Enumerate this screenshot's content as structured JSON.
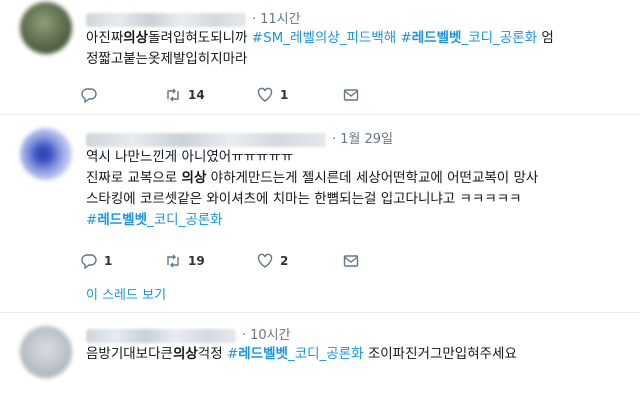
{
  "tweets": [
    {
      "time": "11시간",
      "lines": [
        [
          {
            "t": "아진짜"
          },
          {
            "t": "의상",
            "b": true
          },
          {
            "t": "돌려입혀도되니까 "
          },
          {
            "t": "#SM_레벨의상_피드백해 ",
            "hl": true
          },
          {
            "t": "#",
            "hl": true
          },
          {
            "t": "레드벨벳",
            "hl": true,
            "b": true
          },
          {
            "t": "_코디_공론화",
            "hl": true
          },
          {
            "t": " 엄"
          }
        ],
        [
          {
            "t": "정짧고붙는옷제발입히지마라"
          }
        ]
      ],
      "actions": {
        "reply": "",
        "retweet": "14",
        "like": "1"
      }
    },
    {
      "time": "1월 29일",
      "lines": [
        [
          {
            "t": "역시 나만느낀게 아니였어ㅠㅠㅠㅠㅠ"
          }
        ],
        [
          {
            "t": "진짜로 교복으로 "
          },
          {
            "t": "의상",
            "b": true
          },
          {
            "t": " 야하게만드는게 젤시른데 세상어떤학교에 어떤교복이 망사"
          }
        ],
        [
          {
            "t": "스타킹에 코르셋같은 와이셔츠에 치마는 한뼘되는걸 입고다니냐고 ㅋㅋㅋㅋㅋ"
          }
        ],
        [
          {
            "t": "#",
            "hl": true
          },
          {
            "t": "레드벨벳",
            "hl": true,
            "b": true
          },
          {
            "t": "_코디_공론화",
            "hl": true
          }
        ]
      ],
      "actions": {
        "reply": "1",
        "retweet": "19",
        "like": "2"
      },
      "thread_link": "이 스레드 보기"
    },
    {
      "time": "10시간",
      "lines": [
        [
          {
            "t": "음방기대보다큰"
          },
          {
            "t": "의상",
            "b": true
          },
          {
            "t": "걱정 "
          },
          {
            "t": "#",
            "hl": true
          },
          {
            "t": "레드벨벳",
            "hl": true,
            "b": true
          },
          {
            "t": "_코디_공론화",
            "hl": true
          },
          {
            "t": " 조이파진거그만입혀주세요"
          }
        ]
      ]
    }
  ],
  "colors": {
    "link": "#1b95e0",
    "muted": "#657786"
  },
  "icons": {
    "reply": "reply-icon",
    "retweet": "retweet-icon",
    "like": "heart-icon",
    "dm": "envelope-icon"
  }
}
